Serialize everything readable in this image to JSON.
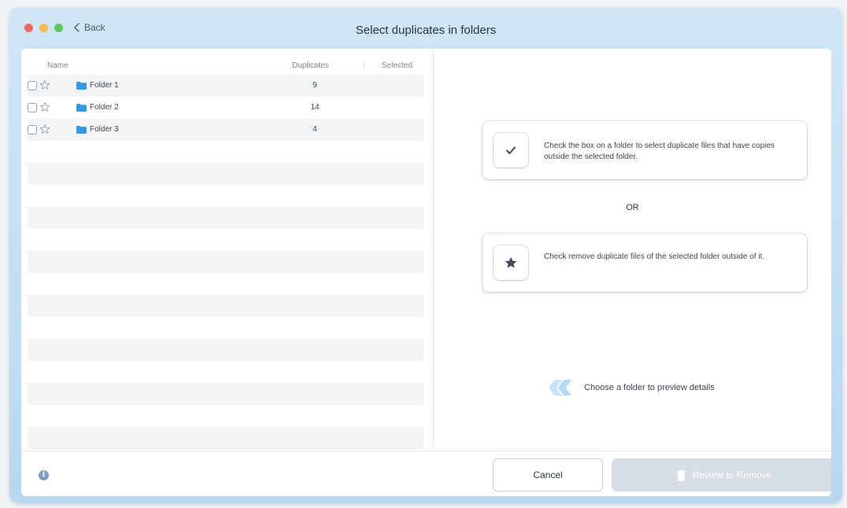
{
  "window": {
    "title": "Select duplicates in folders",
    "back_label": "Back"
  },
  "table": {
    "columns": [
      "Name",
      "Duplicates",
      "Selected"
    ],
    "rows": [
      {
        "name": "Folder 1",
        "duplicates": "9",
        "selected": ""
      },
      {
        "name": "Folder 2",
        "duplicates": "14",
        "selected": ""
      },
      {
        "name": "Folder 3",
        "duplicates": "4",
        "selected": ""
      }
    ],
    "empty_rows": 15
  },
  "help": {
    "checkbox_card": "Check the box on a folder to select duplicate files that have copies outside the selected folder.",
    "or_label": "OR",
    "star_card": "Check remove duplicate files of the selected folder outside of it.",
    "preview_hint": "Choose a folder to preview details"
  },
  "footer": {
    "info_icon": "info-icon",
    "cancel_label": "Cancel",
    "review_label": "Review to Remove",
    "review_enabled": false
  },
  "colors": {
    "folder": "#2f9be8",
    "accent_blue": "#7f9bc4",
    "disabled_button": "#d6dde5"
  }
}
